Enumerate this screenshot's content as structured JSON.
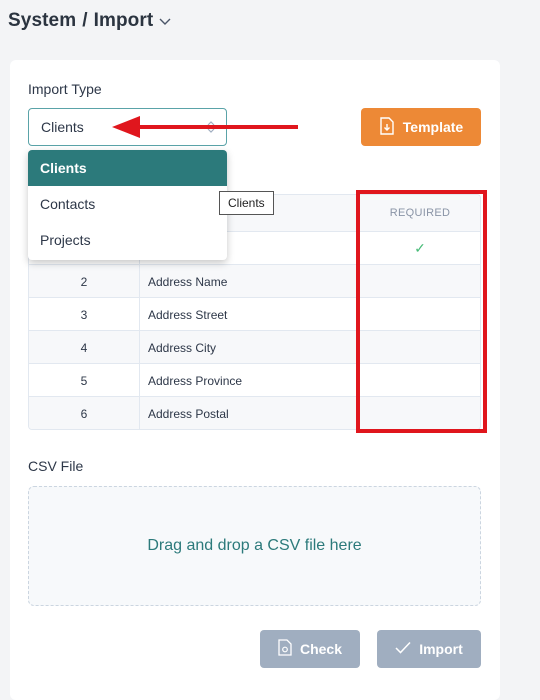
{
  "breadcrumb": {
    "section": "System",
    "separator": "/",
    "page": "Import"
  },
  "import_type": {
    "label": "Import Type",
    "selected": "Clients",
    "options": [
      "Clients",
      "Contacts",
      "Projects"
    ],
    "tooltip": "Clients"
  },
  "template_button": {
    "label": "Template"
  },
  "mapping_table": {
    "header_required": "REQUIRED",
    "rows": [
      {
        "index": "",
        "field": "",
        "required_mark": "✓"
      },
      {
        "index": "2",
        "field": "Address Name",
        "required_mark": ""
      },
      {
        "index": "3",
        "field": "Address Street",
        "required_mark": ""
      },
      {
        "index": "4",
        "field": "Address City",
        "required_mark": ""
      },
      {
        "index": "5",
        "field": "Address Province",
        "required_mark": ""
      },
      {
        "index": "6",
        "field": "Address Postal",
        "required_mark": ""
      }
    ]
  },
  "csv": {
    "label": "CSV File",
    "dropzone_text": "Drag and drop a CSV file here"
  },
  "actions": {
    "check_label": "Check",
    "import_label": "Import"
  },
  "colors": {
    "accent": "#2c7a7b",
    "template": "#ed8936",
    "disabled": "#a0aec0",
    "annotation": "#e0161d"
  }
}
